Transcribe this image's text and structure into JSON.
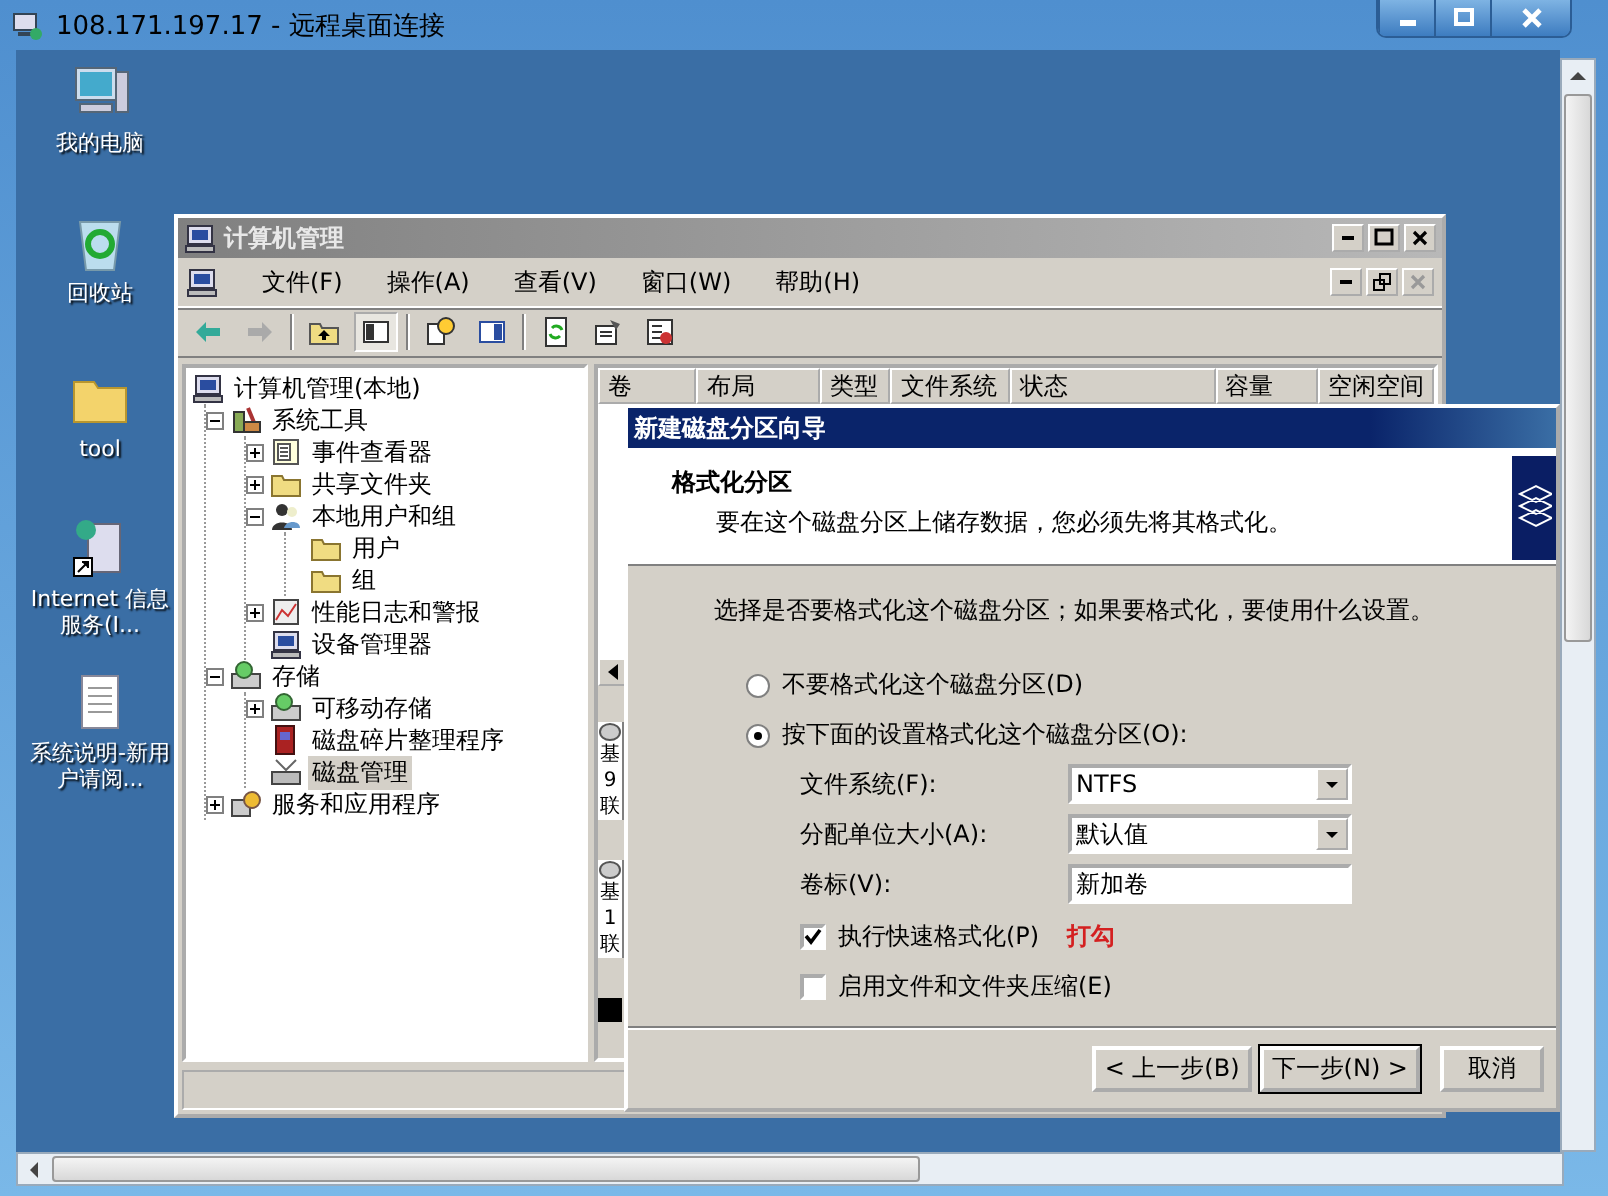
{
  "window": {
    "title": "108.171.197.17 - 远程桌面连接"
  },
  "desktop_icons": [
    {
      "label": "我的电脑",
      "kind": "computer"
    },
    {
      "label": "回收站",
      "kind": "recycle"
    },
    {
      "label": "tool",
      "kind": "folder"
    },
    {
      "label": "Internet 信息服务(I...",
      "kind": "shortcut"
    },
    {
      "label": "系统说明-新用户请阅...",
      "kind": "document"
    }
  ],
  "management": {
    "title": "计算机管理",
    "menu": [
      "文件(F)",
      "操作(A)",
      "查看(V)",
      "窗口(W)",
      "帮助(H)"
    ],
    "toolbar": [
      {
        "kind": "back",
        "pressed": false
      },
      {
        "kind": "forward",
        "pressed": false
      },
      {
        "kind": "up",
        "pressed": false
      },
      {
        "kind": "tree",
        "pressed": true
      },
      {
        "kind": "help",
        "pressed": false
      },
      {
        "kind": "panel",
        "pressed": false
      },
      {
        "kind": "refresh",
        "pressed": false
      },
      {
        "kind": "properties",
        "pressed": false
      },
      {
        "kind": "export",
        "pressed": false
      }
    ],
    "tree": [
      {
        "label": "计算机管理(本地)",
        "kind": "computer",
        "selected": false,
        "children": [
          {
            "label": "系统工具",
            "kind": "tools",
            "expanded": true,
            "selected": false,
            "children": [
              {
                "label": "事件查看器",
                "kind": "log",
                "expanded": false,
                "selected": false
              },
              {
                "label": "共享文件夹",
                "kind": "folder",
                "expanded": false,
                "selected": false
              },
              {
                "label": "本地用户和组",
                "kind": "users",
                "expanded": true,
                "selected": false,
                "children": [
                  {
                    "label": "用户",
                    "kind": "folder",
                    "selected": false
                  },
                  {
                    "label": "组",
                    "kind": "folder",
                    "selected": false
                  }
                ]
              },
              {
                "label": "性能日志和警报",
                "kind": "chart",
                "expanded": false,
                "selected": false
              },
              {
                "label": "设备管理器",
                "kind": "computer",
                "selected": false
              }
            ]
          },
          {
            "label": "存储",
            "kind": "storage",
            "expanded": true,
            "selected": false,
            "children": [
              {
                "label": "可移动存储",
                "kind": "storage",
                "expanded": false,
                "selected": false
              },
              {
                "label": "磁盘碎片整理程序",
                "kind": "defrag",
                "selected": false
              },
              {
                "label": "磁盘管理",
                "kind": "disk",
                "selected": true
              }
            ]
          },
          {
            "label": "服务和应用程序",
            "kind": "gear",
            "expanded": false,
            "selected": false
          }
        ]
      }
    ],
    "columns": [
      "卷",
      "布局",
      "类型",
      "文件系统",
      "状态",
      "容量",
      "空闲空间"
    ],
    "disks": [
      {
        "lines": [
          "基",
          "9",
          "联"
        ]
      },
      {
        "lines": [
          "基",
          "1",
          "联"
        ]
      }
    ]
  },
  "wizard": {
    "title": "新建磁盘分区向导",
    "header_title": "格式化分区",
    "header_subtitle": "要在这个磁盘分区上储存数据，您必须先将其格式化。",
    "instruction": "选择是否要格式化这个磁盘分区；如果要格式化，要使用什么设置。",
    "radios": [
      {
        "label": "不要格式化这个磁盘分区(D)",
        "selected": false
      },
      {
        "label": "按下面的设置格式化这个磁盘分区(O):",
        "selected": true
      }
    ],
    "fields": [
      {
        "label": "文件系统(F):",
        "value": "NTFS",
        "kind": "dropdown"
      },
      {
        "label": "分配单位大小(A):",
        "value": "默认值",
        "kind": "dropdown"
      },
      {
        "label": "卷标(V):",
        "value": "新加卷",
        "kind": "text"
      }
    ],
    "options": [
      {
        "label": "执行快速格式化(P)",
        "checked": true,
        "annotation": "打勾"
      },
      {
        "label": "启用文件和文件夹压缩(E)",
        "checked": false
      }
    ],
    "buttons": [
      {
        "label": "< 上一步(B)",
        "kind": "back"
      },
      {
        "label": "下一步(N) >",
        "kind": "next"
      },
      {
        "label": "取消",
        "kind": "cancel"
      }
    ]
  }
}
